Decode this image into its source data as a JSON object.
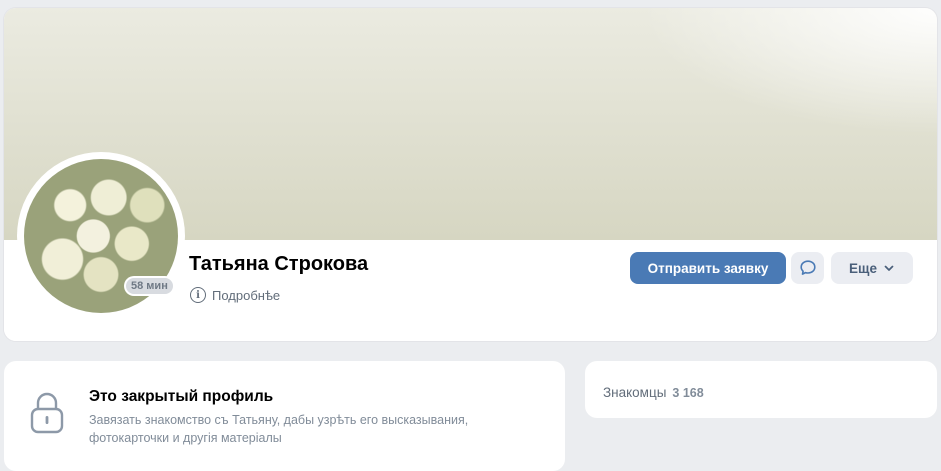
{
  "profile": {
    "name": "Татьяна Строкова",
    "online_status": "58 мин",
    "details_label": "Подробнѣе",
    "send_request_label": "Отправить заявку",
    "more_label": "Еще"
  },
  "closed_profile": {
    "title": "Это закрытый профиль",
    "description": "Завязать знакомство съ Татьяну, дабы узрѣть его высказывания, фотокарточки и другія матеріалы"
  },
  "friends": {
    "label": "Знакомцы",
    "count": "3 168"
  },
  "colors": {
    "accent": "#4a7ab5",
    "background": "#ebedf0",
    "secondary_button": "#ebedf2"
  },
  "icons": {
    "info": "info-icon",
    "message": "message-icon",
    "chevron": "chevron-down-icon",
    "lock": "lock-icon"
  }
}
